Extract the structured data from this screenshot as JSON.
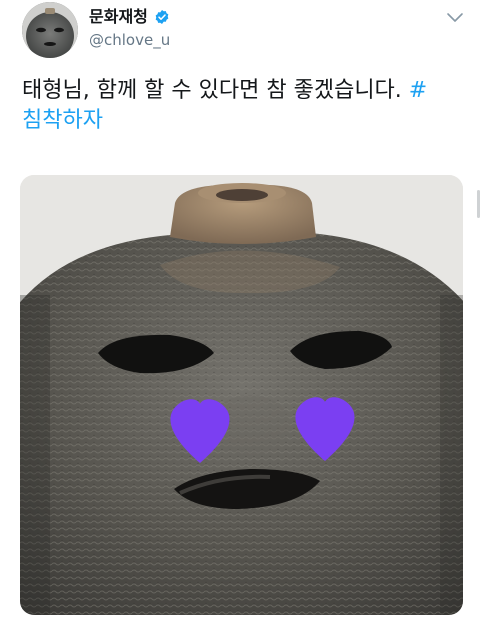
{
  "tweet": {
    "display_name": "문화재청",
    "handle": "@chlove_u",
    "text": "태형님, 함께 할 수 있다면 참 좋겠습니다.",
    "hashtag_part1": "#",
    "hashtag_part2": "침착하자"
  },
  "icons": {
    "verified": "verified-badge-icon",
    "caret": "chevron-down-icon"
  },
  "colors": {
    "hashtag": "#1da1f2",
    "verified": "#1da1f2",
    "heart": "#7b3ff2",
    "handle": "#657786"
  }
}
